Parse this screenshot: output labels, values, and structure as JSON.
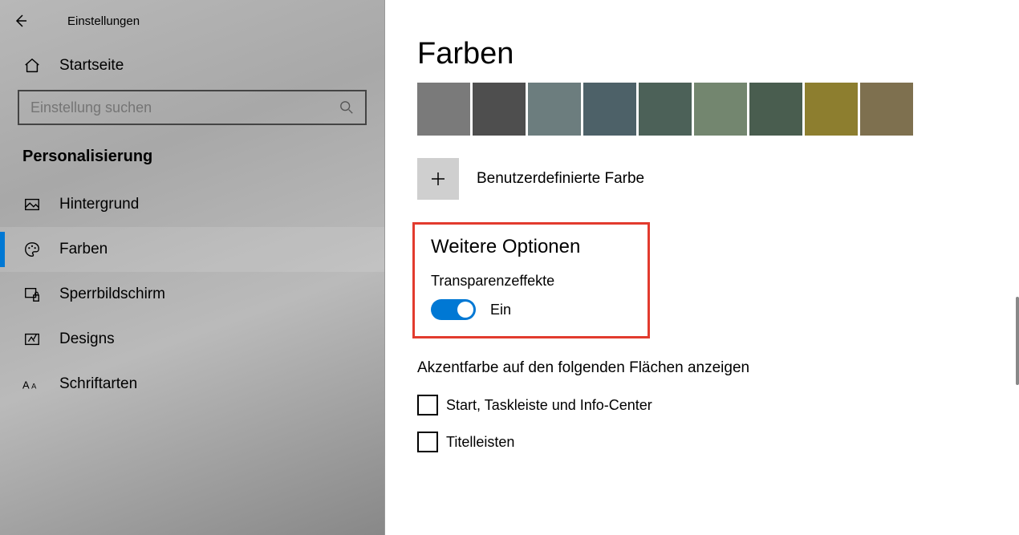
{
  "window": {
    "title": "Einstellungen"
  },
  "sidebar": {
    "home": "Startseite",
    "search_placeholder": "Einstellung suchen",
    "section": "Personalisierung",
    "items": [
      {
        "label": "Hintergrund",
        "icon": "image-icon",
        "active": false
      },
      {
        "label": "Farben",
        "icon": "palette-icon",
        "active": true
      },
      {
        "label": "Sperrbildschirm",
        "icon": "lockscreen-icon",
        "active": false
      },
      {
        "label": "Designs",
        "icon": "designs-icon",
        "active": false
      },
      {
        "label": "Schriftarten",
        "icon": "fonts-icon",
        "active": false
      }
    ]
  },
  "content": {
    "heading": "Farben",
    "swatches": [
      "#7a7a7a",
      "#4e4e4e",
      "#6c7d7e",
      "#4d6168",
      "#4c6158",
      "#73866f",
      "#495d4f",
      "#8d7e2f",
      "#7e704f"
    ],
    "custom_color_label": "Benutzerdefinierte Farbe",
    "more_options_heading": "Weitere Optionen",
    "transparency": {
      "label": "Transparenzeffekte",
      "state": "Ein"
    },
    "accent_heading": "Akzentfarbe auf den folgenden Flächen anzeigen",
    "checks": [
      {
        "label": "Start, Taskleiste und Info-Center"
      },
      {
        "label": "Titelleisten"
      }
    ]
  }
}
